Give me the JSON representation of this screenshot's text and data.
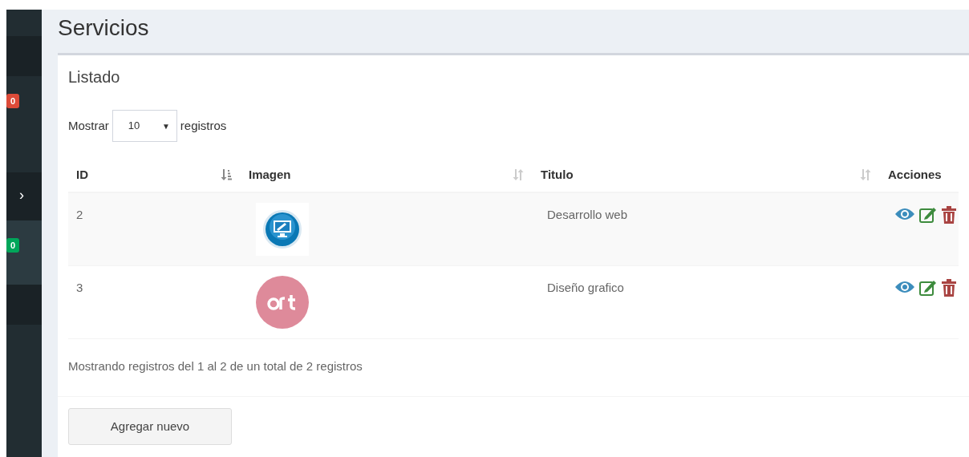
{
  "sidebar": {
    "items": [
      {
        "kind": "plain",
        "active": false
      },
      {
        "kind": "plain",
        "active": false
      },
      {
        "kind": "badge",
        "active": false,
        "badge": "0",
        "color": "#dd4b39"
      },
      {
        "kind": "chevron",
        "active": false,
        "icon": "›"
      },
      {
        "kind": "badge",
        "active": true,
        "badge": "0",
        "color": "#00a65a"
      },
      {
        "kind": "plain",
        "active": false
      },
      {
        "kind": "plain",
        "active": false
      }
    ]
  },
  "page_title": "Servicios",
  "box": {
    "title": "Listado",
    "length_menu": {
      "label_before": "Mostrar",
      "value": "10",
      "caret": "▼",
      "label_after": "registros"
    },
    "table": {
      "columns": [
        {
          "label": "ID",
          "sorted": true
        },
        {
          "label": "Imagen",
          "sorted": false
        },
        {
          "label": "Titulo",
          "sorted": false
        },
        {
          "label": "Acciones"
        }
      ],
      "rows": [
        {
          "id": "2",
          "title": "Desarrollo web"
        },
        {
          "id": "3",
          "title": "Diseño grafico"
        }
      ]
    },
    "info": "Mostrando registros del 1 al 2 de un total de 2 registros",
    "button": "Agregar nuevo"
  }
}
